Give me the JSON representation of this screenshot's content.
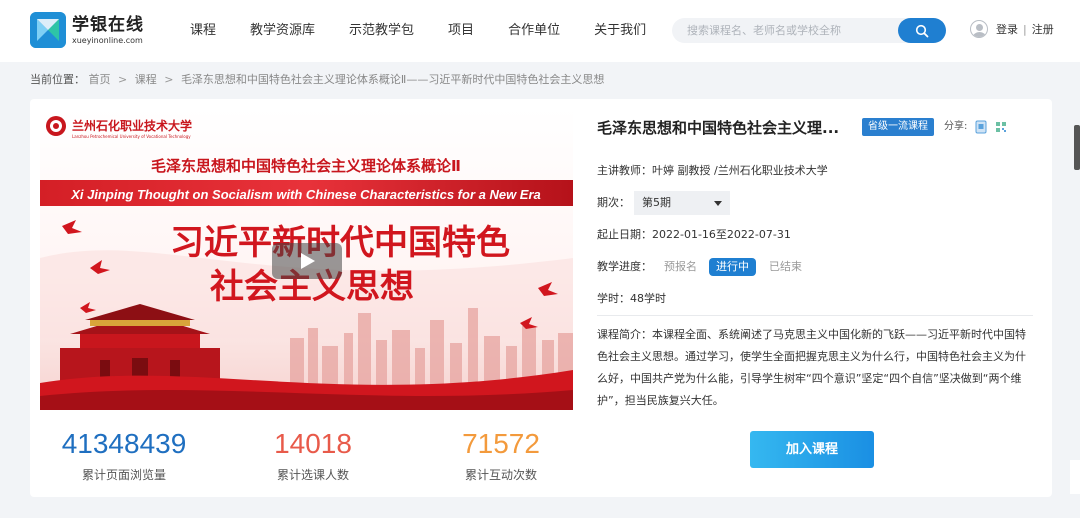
{
  "header": {
    "logo_cn": "学银在线",
    "logo_en": "xueyinonline.com",
    "nav": [
      "课程",
      "教学资源库",
      "示范教学包",
      "项目",
      "合作单位",
      "关于我们"
    ],
    "search_placeholder": "搜索课程名、老师名或学校全称",
    "login": "登录",
    "separator": "|",
    "register": "注册"
  },
  "breadcrumb": {
    "label": "当前位置：",
    "items": [
      "首页",
      "课程",
      "毛泽东思想和中国特色社会主义理论体系概论Ⅱ——习近平新时代中国特色社会主义思想"
    ],
    "arrow": ">"
  },
  "cover": {
    "school_cn": "兰州石化职业技术大学",
    "school_en": "Lanzhou Petrochemical University of Vocational Technology",
    "title_cn": "毛泽东思想和中国特色社会主义理论体系概论Ⅱ",
    "title_en": "Xi Jinping Thought on Socialism with Chinese Characteristics for a New Era",
    "headline_1": "习近平新时代中国特色",
    "headline_2": "社会主义思想"
  },
  "stats": [
    {
      "value": "41348439",
      "label": "累计页面浏览量",
      "color": "#1f6fc0"
    },
    {
      "value": "14018",
      "label": "累计选课人数",
      "color": "#e85a4a"
    },
    {
      "value": "71572",
      "label": "累计互动次数",
      "color": "#f39a3c"
    }
  ],
  "course": {
    "title": "毛泽东思想和中国特色社会主义理...",
    "badge": "省级一流课程",
    "share_label": "分享:",
    "teacher_label": "主讲教师：",
    "teacher": "叶婷 副教授 /兰州石化职业技术大学",
    "period_label": "期次：",
    "period": "第5期",
    "date_label": "起止日期：",
    "dates": "2022-01-16至2022-07-31",
    "progress_label": "教学进度：",
    "progress_steps": [
      "预报名",
      "进行中",
      "已结束"
    ],
    "hours_label": "学时：",
    "hours": "48学时",
    "intro_label": "课程简介：",
    "intro": "本课程全面、系统阐述了马克思主义中国化新的飞跃——习近平新时代中国特色社会主义思想。通过学习，使学生全面把握克思主义为什么行，中国特色社会主义为什么好，中国共产党为什么能，引导学生树牢“四个意识”坚定“四个自信”坚决做到“两个维护”，担当民族复兴大任。",
    "join_button": "加入课程"
  },
  "colors": {
    "brand_blue": "#1f7fd1",
    "cover_red": "#c8161d"
  }
}
